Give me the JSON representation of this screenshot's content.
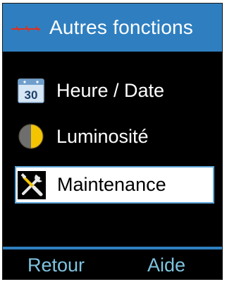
{
  "header": {
    "logo_icon": "brand-logo-icon",
    "title": "Autres fonctions"
  },
  "menu": {
    "items": [
      {
        "label": "Heure / Date",
        "icon": "calendar-icon",
        "icon_text": "30",
        "selected": false
      },
      {
        "label": "Luminosité",
        "icon": "brightness-icon",
        "selected": false
      },
      {
        "label": "Maintenance",
        "icon": "tools-icon",
        "selected": true
      }
    ]
  },
  "softkeys": {
    "left": "Retour",
    "right": "Aide"
  },
  "colors": {
    "header_bg": "#2f7fc0",
    "screen_bg": "#000000",
    "softkey_text": "#7ec3df",
    "selection_border": "#5fa6d6",
    "logo_red": "#e0301e"
  }
}
